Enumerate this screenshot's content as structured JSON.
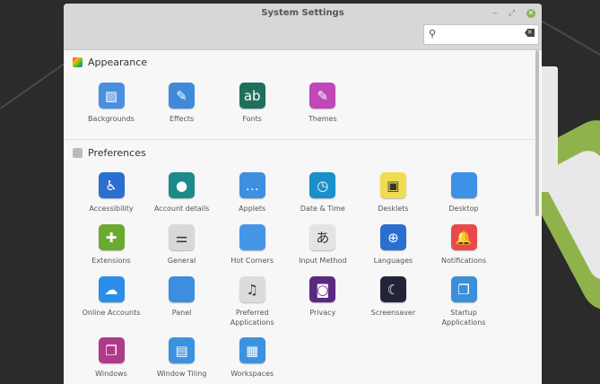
{
  "window": {
    "title": "System Settings",
    "minimize": "‒",
    "maximize": "⤢",
    "close": "✕"
  },
  "search": {
    "placeholder": "",
    "value": ""
  },
  "sections": [
    {
      "title": "Appearance",
      "items": [
        {
          "label": "Backgrounds",
          "icon": "backgrounds-icon",
          "color": "#4a8fe0",
          "glyph": "▨"
        },
        {
          "label": "Effects",
          "icon": "effects-icon",
          "color": "#3f8ad8",
          "glyph": "✎"
        },
        {
          "label": "Fonts",
          "icon": "fonts-icon",
          "color": "#1e6f5c",
          "glyph": "ab"
        },
        {
          "label": "Themes",
          "icon": "themes-icon",
          "color": "#c048b8",
          "glyph": "✎"
        }
      ]
    },
    {
      "title": "Preferences",
      "items": [
        {
          "label": "Accessibility",
          "icon": "accessibility-icon",
          "color": "#2a6fd0",
          "glyph": "♿"
        },
        {
          "label": "Account details",
          "icon": "account-icon",
          "color": "#1c8a8a",
          "glyph": "●"
        },
        {
          "label": "Applets",
          "icon": "applets-icon",
          "color": "#3d8fe0",
          "glyph": "…"
        },
        {
          "label": "Date & Time",
          "icon": "clock-icon",
          "color": "#1a8fc9",
          "glyph": "◷"
        },
        {
          "label": "Desklets",
          "icon": "desklets-icon",
          "color": "#f0dc50",
          "glyph": "▣"
        },
        {
          "label": "Desktop",
          "icon": "desktop-icon",
          "color": "#3d92e6",
          "glyph": ""
        },
        {
          "label": "Extensions",
          "icon": "puzzle-icon",
          "color": "#6aaa2e",
          "glyph": "✚"
        },
        {
          "label": "General",
          "icon": "toggles-icon",
          "color": "#d8d8d8",
          "glyph": "⚌"
        },
        {
          "label": "Hot Corners",
          "icon": "hot-corners-icon",
          "color": "#4696e8",
          "glyph": ""
        },
        {
          "label": "Input Method",
          "icon": "input-method-icon",
          "color": "#e4e4e4",
          "glyph": "あ"
        },
        {
          "label": "Languages",
          "icon": "globe-icon",
          "color": "#2a6fd0",
          "glyph": "⊕"
        },
        {
          "label": "Notifications",
          "icon": "bell-icon",
          "color": "#e84a4a",
          "glyph": "🔔"
        },
        {
          "label": "Online Accounts",
          "icon": "cloud-icon",
          "color": "#2a8ee8",
          "glyph": "☁"
        },
        {
          "label": "Panel",
          "icon": "panel-icon",
          "color": "#3d8ee0",
          "glyph": ""
        },
        {
          "label": "Preferred Applications",
          "icon": "media-icon",
          "color": "#dcdcdc",
          "glyph": "♫"
        },
        {
          "label": "Privacy",
          "icon": "mask-icon",
          "color": "#5a2a80",
          "glyph": "◙"
        },
        {
          "label": "Screensaver",
          "icon": "moon-icon",
          "color": "#22253a",
          "glyph": "☾"
        },
        {
          "label": "Startup Applications",
          "icon": "startup-icon",
          "color": "#3a90d8",
          "glyph": "❐"
        },
        {
          "label": "Windows",
          "icon": "windows-icon",
          "color": "#b03a8a",
          "glyph": "❐"
        },
        {
          "label": "Window Tiling",
          "icon": "tiling-icon",
          "color": "#3d92e0",
          "glyph": "▤"
        },
        {
          "label": "Workspaces",
          "icon": "workspaces-icon",
          "color": "#3d92e0",
          "glyph": "▦"
        }
      ]
    }
  ]
}
